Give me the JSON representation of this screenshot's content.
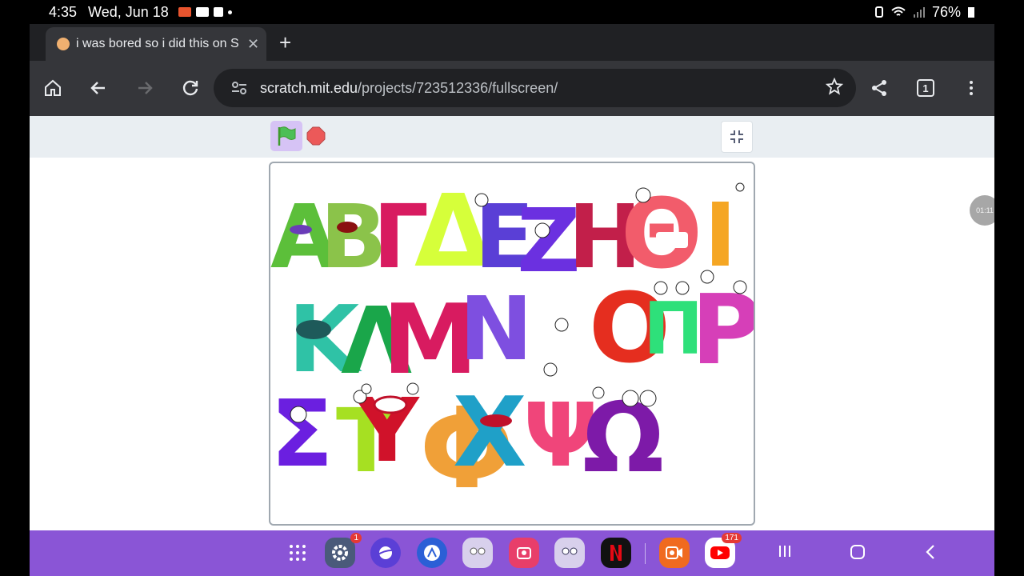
{
  "status": {
    "time": "4:35",
    "date": "Wed, Jun 18",
    "battery": "76%"
  },
  "tab": {
    "title": "i was bored so i did this on S",
    "close": "✕",
    "new_tab": "+"
  },
  "omnibox": {
    "host": "scratch.mit.edu",
    "path": "/projects/723512336/fullscreen/"
  },
  "toolbar": {
    "tab_count": "1"
  },
  "stage": {
    "bubble_text": "01:11"
  },
  "taskbar": {
    "settings_badge": "1",
    "youtube_badge": "171"
  },
  "stage_letters": {
    "row1": [
      "Α",
      "Β",
      "Γ",
      "Δ",
      "Ε",
      "Ζ",
      "Η",
      "Θ",
      "Ι"
    ],
    "row2": [
      "Κ",
      "Λ",
      "Μ",
      "Ν",
      "Ο",
      "Π",
      "Ρ"
    ],
    "row3": [
      "Σ",
      "Τ",
      "Υ",
      "Φ",
      "Χ",
      "Ψ",
      "Ω"
    ]
  },
  "colors": {
    "accent": "#8a55d6",
    "chrome_dark": "#202124",
    "chrome_toolbar": "#35363a"
  }
}
